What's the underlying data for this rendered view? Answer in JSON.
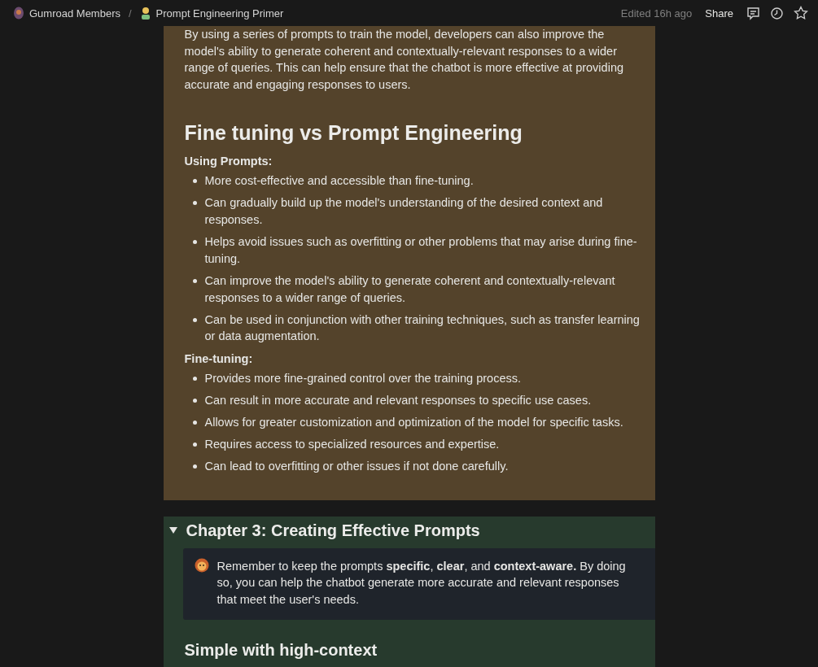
{
  "topbar": {
    "breadcrumbs": [
      {
        "label": "Gumroad Members"
      },
      {
        "label": "Prompt Engineering Primer"
      }
    ],
    "separator": "/",
    "edited": "Edited 16h ago",
    "share": "Share"
  },
  "upper_block": {
    "paragraph": "By using a series of prompts to train the model, developers can also improve the model's ability to generate coherent and contextually-relevant responses to a wider range of queries. This can help ensure that the chatbot is more effective at providing accurate and engaging responses to users.",
    "heading": "Fine tuning vs Prompt Engineering",
    "lists": [
      {
        "title": "Using Prompts:",
        "items": [
          "More cost-effective and accessible than fine-tuning.",
          "Can gradually build up the model's understanding of the desired context and responses.",
          "Helps avoid issues such as overfitting or other problems that may arise during fine-tuning.",
          "Can improve the model's ability to generate coherent and contextually-relevant responses to a wider range of queries.",
          "Can be used in conjunction with other training techniques, such as transfer learning or data augmentation."
        ]
      },
      {
        "title": "Fine-tuning:",
        "items": [
          "Provides more fine-grained control over the training process.",
          "Can result in more accurate and relevant responses to specific use cases.",
          "Allows for greater customization and optimization of the model for specific tasks.",
          "Requires access to specialized resources and expertise.",
          "Can lead to overfitting or other issues if not done carefully."
        ]
      }
    ]
  },
  "toggle": {
    "title": "Chapter 3: Creating Effective Prompts",
    "expanded": true,
    "callout": {
      "text": "Remember to keep the prompts **specific**, **clear**, and **context-aware.** By doing so, you can help the chatbot generate more accurate and relevant responses that meet the user's needs."
    },
    "subheading": "Simple with high-context"
  }
}
